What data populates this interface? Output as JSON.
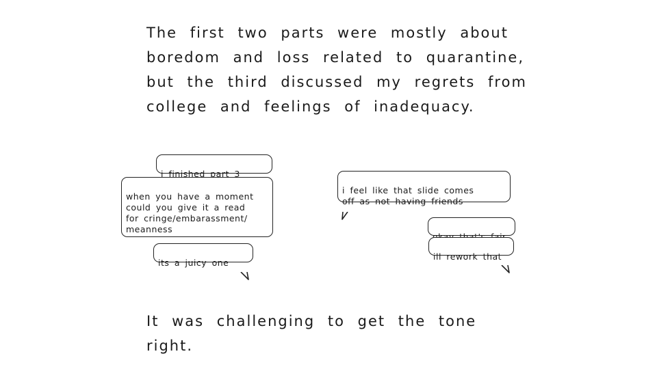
{
  "narration": {
    "intro": "The first two parts were mostly about boredom and loss related to quarantine, but the third discussed my regrets from college and feelings of inadequacy.",
    "outro": "It was challenging to get the tone right."
  },
  "conversation": {
    "sent_messages": [
      {
        "text": "i finished part 3"
      },
      {
        "text": "when you have a moment\ncould you give it a read\nfor cringe/embarassment/\nmeanness"
      },
      {
        "text": "its a juicy one"
      }
    ],
    "received_message": {
      "text": "i feel like that slide comes\noff as not having friends"
    },
    "reply_messages": [
      {
        "text": "okay that's fair"
      },
      {
        "text": "ill rework that"
      }
    ]
  }
}
